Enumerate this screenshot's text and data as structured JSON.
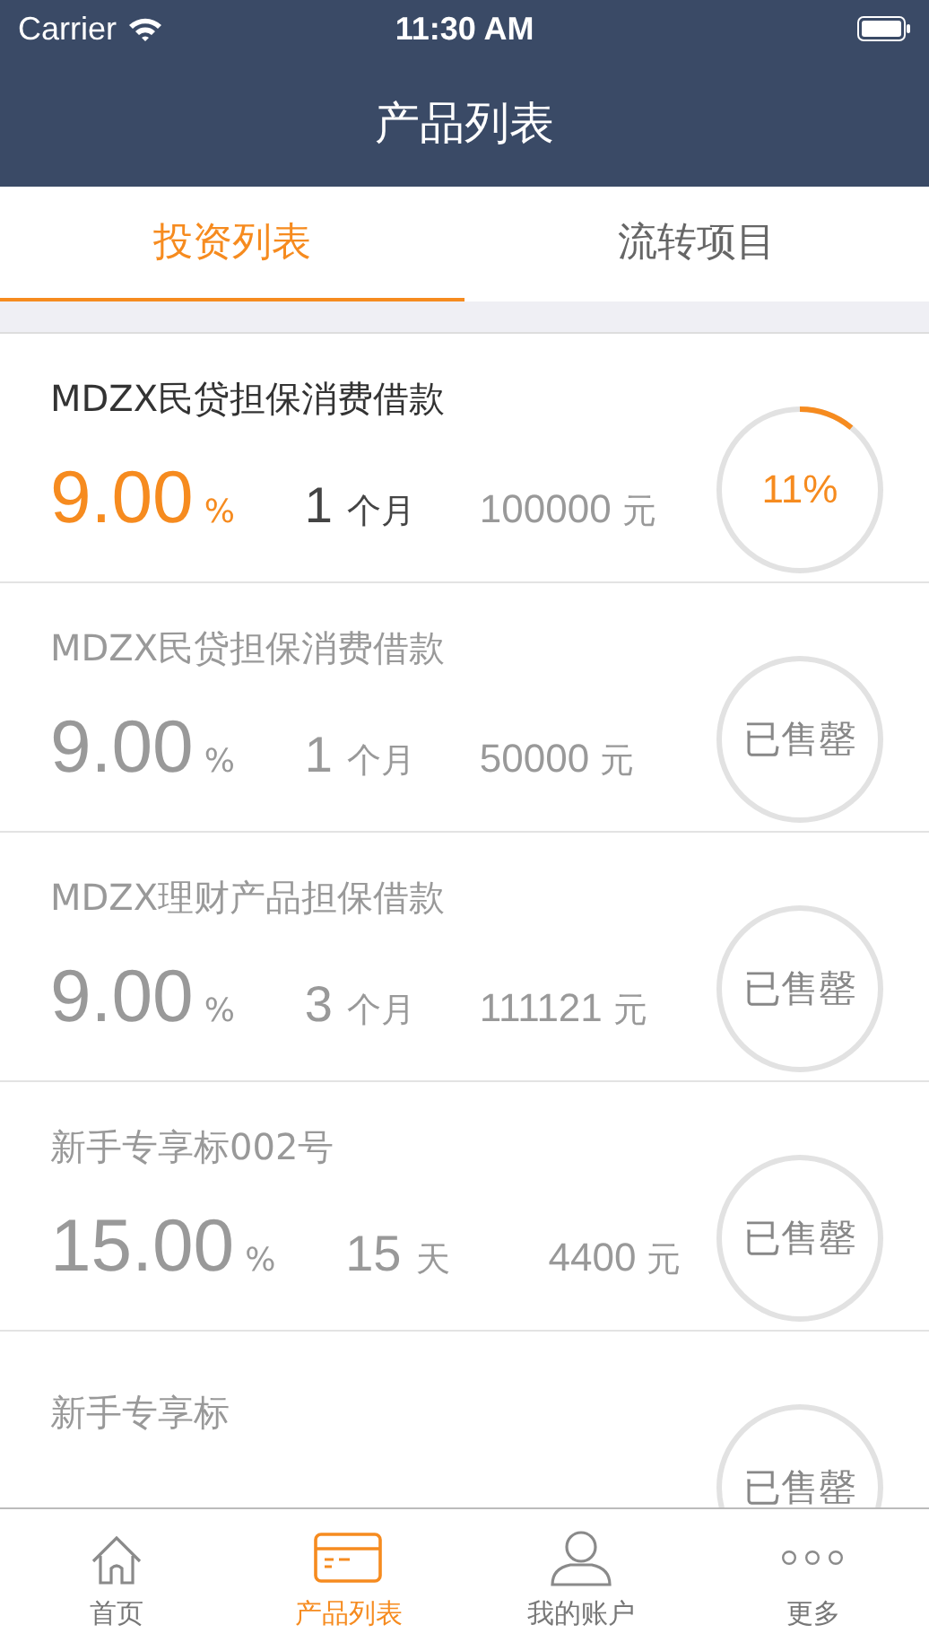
{
  "status_bar": {
    "carrier": "Carrier",
    "time": "11:30 AM"
  },
  "nav_bar": {
    "title": "产品列表"
  },
  "tabs": [
    {
      "label": "投资列表",
      "selected": true
    },
    {
      "label": "流转项目",
      "selected": false
    }
  ],
  "products": [
    {
      "kind": "open",
      "title": "MDZX民贷担保消费借款",
      "rate": "9.00",
      "rate_unit": "%",
      "term": "1",
      "term_unit": "个月",
      "amount": "100000",
      "amount_unit": "元",
      "badge": "11%",
      "level": 0.11
    },
    {
      "kind": "sold_out",
      "title": "MDZX民贷担保消费借款",
      "rate": "9.00",
      "rate_unit": "%",
      "term": "1",
      "term_unit": "个月",
      "amount": "50000",
      "amount_unit": "元",
      "badge": "已售罄"
    },
    {
      "kind": "sold_out",
      "title": "MDZX理财产品担保借款",
      "rate": "9.00",
      "rate_unit": "%",
      "term": "3",
      "term_unit": "个月",
      "amount": "111121",
      "amount_unit": "元",
      "badge": "已售罄"
    },
    {
      "kind": "sold_out",
      "title": "新手专享标002号",
      "rate": "15.00",
      "rate_unit": "%",
      "term": "15",
      "term_unit": "天",
      "amount": "4400",
      "amount_unit": "元",
      "badge": "已售罄"
    },
    {
      "kind": "sold_out",
      "title": "新手专享标",
      "badge": "已售罄"
    }
  ],
  "tab_bar": [
    {
      "label": "首页",
      "selected": false
    },
    {
      "label": "产品列表",
      "selected": true
    },
    {
      "label": "我的账户",
      "selected": false
    },
    {
      "label": "更多",
      "selected": false
    }
  ]
}
